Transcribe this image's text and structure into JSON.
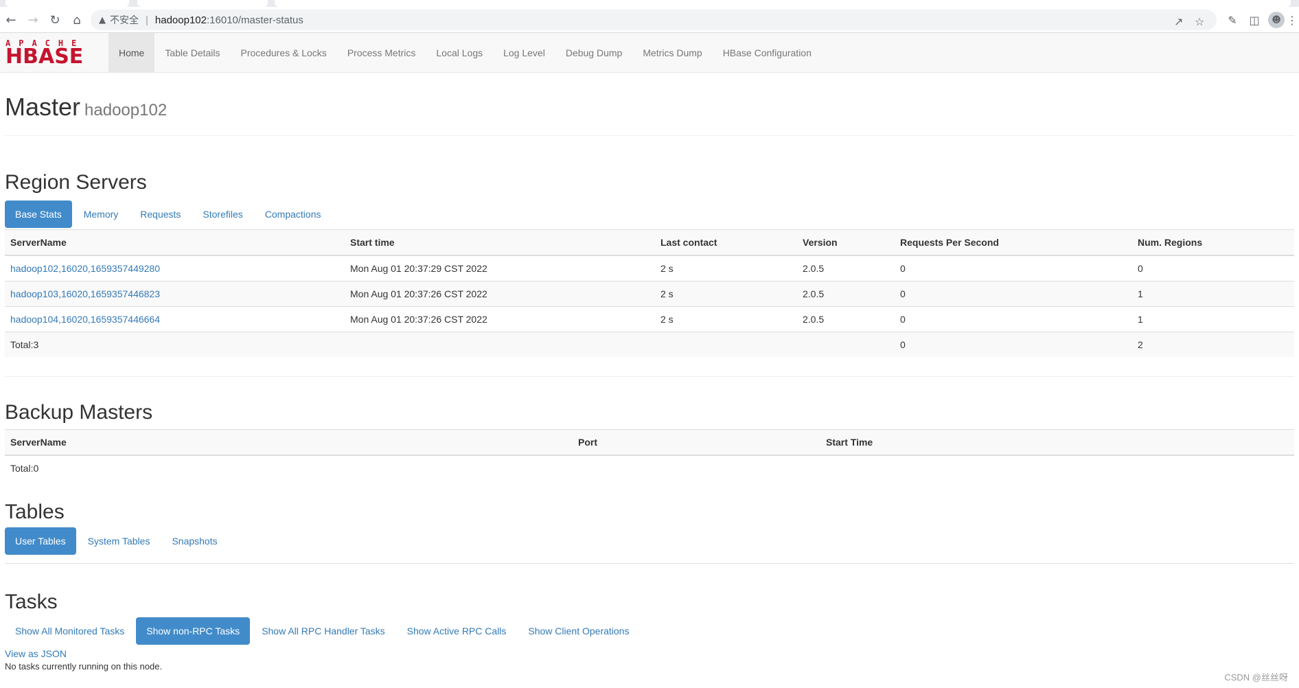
{
  "browser": {
    "security_label": "不安全",
    "url_host": "hadoop102",
    "url_path": ":16010/master-status"
  },
  "navbar": {
    "logo_top": "APACHE",
    "logo_main": "HBASE",
    "links": [
      {
        "label": "Home"
      },
      {
        "label": "Table Details"
      },
      {
        "label": "Procedures & Locks"
      },
      {
        "label": "Process Metrics"
      },
      {
        "label": "Local Logs"
      },
      {
        "label": "Log Level"
      },
      {
        "label": "Debug Dump"
      },
      {
        "label": "Metrics Dump"
      },
      {
        "label": "HBase Configuration"
      }
    ]
  },
  "header": {
    "title": "Master",
    "subtitle": "hadoop102"
  },
  "region_servers": {
    "title": "Region Servers",
    "tabs": [
      {
        "label": "Base Stats"
      },
      {
        "label": "Memory"
      },
      {
        "label": "Requests"
      },
      {
        "label": "Storefiles"
      },
      {
        "label": "Compactions"
      }
    ],
    "columns": [
      "ServerName",
      "Start time",
      "Last contact",
      "Version",
      "Requests Per Second",
      "Num. Regions"
    ],
    "rows": [
      [
        "hadoop102,16020,1659357449280",
        "Mon Aug 01 20:37:29 CST 2022",
        "2 s",
        "2.0.5",
        "0",
        "0"
      ],
      [
        "hadoop103,16020,1659357446823",
        "Mon Aug 01 20:37:26 CST 2022",
        "2 s",
        "2.0.5",
        "0",
        "1"
      ],
      [
        "hadoop104,16020,1659357446664",
        "Mon Aug 01 20:37:26 CST 2022",
        "2 s",
        "2.0.5",
        "0",
        "1"
      ]
    ],
    "total": {
      "label": "Total:3",
      "requests": "0",
      "regions": "2"
    }
  },
  "backup_masters": {
    "title": "Backup Masters",
    "columns": [
      "ServerName",
      "Port",
      "Start Time"
    ],
    "total": "Total:0"
  },
  "tables": {
    "title": "Tables",
    "tabs": [
      {
        "label": "User Tables"
      },
      {
        "label": "System Tables"
      },
      {
        "label": "Snapshots"
      }
    ]
  },
  "tasks": {
    "title": "Tasks",
    "tabs": [
      {
        "label": "Show All Monitored Tasks"
      },
      {
        "label": "Show non-RPC Tasks"
      },
      {
        "label": "Show All RPC Handler Tasks"
      },
      {
        "label": "Show Active RPC Calls"
      },
      {
        "label": "Show Client Operations"
      }
    ],
    "view_json": "View as JSON",
    "status": "No tasks currently running on this node."
  },
  "watermark": "CSDN @丝丝呀",
  "colors": {
    "accent": "#428bca",
    "link": "#337ab7",
    "logo": "#c5142f"
  }
}
